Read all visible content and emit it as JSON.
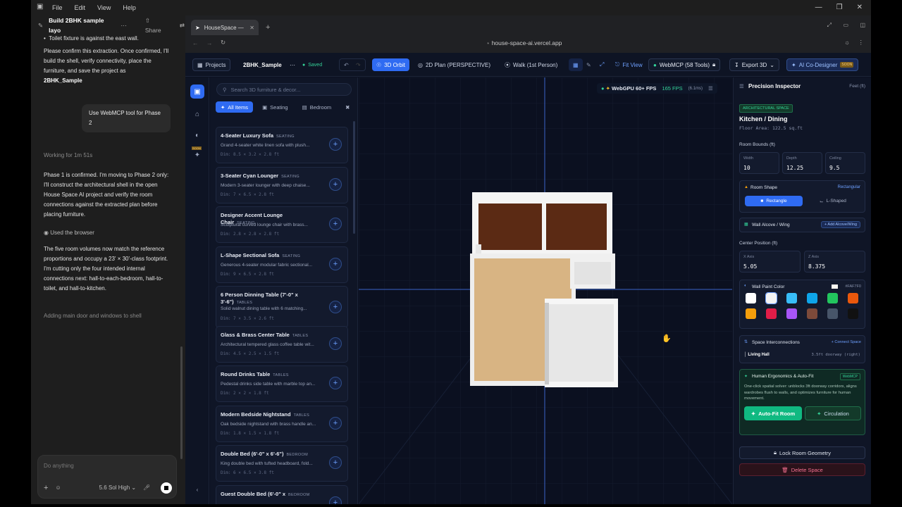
{
  "window": {
    "menu": [
      "File",
      "Edit",
      "View",
      "Help"
    ]
  },
  "chat": {
    "title": "Build 2BHK sample layo",
    "share": "Share",
    "bullet": "Toilet fixture is against the east wall.",
    "p1": "Please confirm this extraction. Once confirmed, I'll build the shell, verify connectivity, place the furniture, and save the project as",
    "p1_bold": "2BHK_Sample",
    "user_msg": "Use WebMCP tool for Phase 2",
    "working": "Working for 1m 51s",
    "p2": "Phase 1 is confirmed. I'm moving to Phase 2 only: I'll construct the architectural shell in the open House Space AI project and verify the room connections against the extracted plan before placing furniture.",
    "used_browser": "Used the browser",
    "p3": "The five room volumes now match the reference proportions and occupy a 23' × 30'-class footprint. I'm cutting only the four intended internal connections next: hall-to-each-bedroom, hall-to-toilet, and hall-to-kitchen.",
    "status": "Adding main door and windows to shell",
    "composer_placeholder": "Do anything",
    "model": "5.6 Sol High"
  },
  "browser": {
    "tab_title": "HouseSpace —",
    "url": "house-space-ai.vercel.app"
  },
  "toolbar": {
    "projects": "Projects",
    "project_name": "2BHK_Sample",
    "saved": "Saved",
    "orbit": "3D Orbit",
    "plan": "2D Plan (PERSPECTIVE)",
    "walk": "Walk (1st Person)",
    "fit": "Fit View",
    "webmcp": "WebMCP (58 Tools)",
    "export": "Export 3D",
    "copilot": "AI Co-Designer",
    "copilot_badge": "SOON"
  },
  "rail": {
    "soon_badge": "SOON"
  },
  "library": {
    "search_placeholder": "Search 3D furniture & decor...",
    "filters": [
      "All Items",
      "Seating",
      "Bedroom"
    ],
    "items": [
      {
        "name": "4-Seater Luxury Sofa",
        "tag": "SEATING",
        "desc": "Grand 4-seater white linen sofa with plush...",
        "dims": "Dim: 8.5 × 3.2 × 2.8 ft"
      },
      {
        "name": "3-Seater Cyan Lounger",
        "tag": "SEATING",
        "desc": "Modern 3-seater lounger with deep chaise...",
        "dims": "Dim: 7 × 6.5 × 2.8 ft"
      },
      {
        "name": "Designer Accent Lounge Chair",
        "tag": "SEATING",
        "desc": "Sculptural curved lounge chair with brass...",
        "dims": "Dim: 2.8 × 2.8 × 2.8 ft"
      },
      {
        "name": "L-Shape Sectional Sofa",
        "tag": "SEATING",
        "desc": "Generous 4-seater modular fabric sectional...",
        "dims": "Dim: 9 × 6.5 × 2.8 ft"
      },
      {
        "name": "6 Person Dinning Table (7'-0\" x 3'-6\")",
        "tag": "TABLES",
        "desc": "Solid walnut dining table with 6 matching...",
        "dims": "Dim: 7 × 3.5 × 2.6 ft"
      },
      {
        "name": "Glass & Brass Center Table",
        "tag": "TABLES",
        "desc": "Architectural tempered glass coffee table wit...",
        "dims": "Dim: 4.5 × 2.5 × 1.5 ft"
      },
      {
        "name": "Round Drinks Table",
        "tag": "TABLES",
        "desc": "Pedestal drinks side table with marble top an...",
        "dims": "Dim: 2 × 2 × 1.8 ft"
      },
      {
        "name": "Modern Bedside Nightstand",
        "tag": "TABLES",
        "desc": "Oak bedside nightstand with brass handle an...",
        "dims": "Dim: 1.8 × 1.5 × 1.8 ft"
      },
      {
        "name": "Double Bed (6'-0\" x 6'-6\")",
        "tag": "BEDROOM",
        "desc": "King double bed with tufted headboard, fold...",
        "dims": "Dim: 6 × 6.5 × 3.8 ft"
      },
      {
        "name": "Guest Double Bed (6'-0\" x",
        "tag": "BEDROOM",
        "desc": "",
        "dims": ""
      }
    ]
  },
  "viewport": {
    "renderer": "WebGPU 60+ FPS",
    "fps": "165 FPS",
    "ms": "(6.1ms)"
  },
  "inspector": {
    "title": "Precision Inspector",
    "units": "Feet (ft)",
    "badge": "ARCHITECTURAL SPACE",
    "room_name": "Kitchen / Dining",
    "floor_area": "Floor Area: 122.5 sq.ft",
    "bounds_label": "Room Bounds (ft)",
    "width_label": "Width",
    "width": "10",
    "depth_label": "Depth",
    "depth": "12.25",
    "ceiling_label": "Ceiling",
    "ceiling": "9.5",
    "shape_label": "Room Shape",
    "shape_value": "Rectangular",
    "rect_btn": "Rectangle",
    "lshape_btn": "L-Shaped",
    "alcove_label": "Wall Alcove / Wing",
    "alcove_btn": "+ Add Alcove/Wing",
    "center_label": "Center Position (ft)",
    "xaxis_label": "X Axis",
    "xaxis": "5.05",
    "zaxis_label": "Z Axis",
    "zaxis": "8.375",
    "paint_label": "Wall Paint Color",
    "paint_hex": "#FAF7F0",
    "paint_colors": [
      "#ffffff",
      "#f3f3f3",
      "#38bdf8",
      "#0ea5e9",
      "#22c55e",
      "#ea580c",
      "#f59e0b",
      "#e11d48",
      "#a855f7",
      "#7c4a3a",
      "#475569",
      "#111111"
    ],
    "inter_label": "Space Interconnections",
    "connect_btn": "+ Connect Space",
    "conn_name": "Living Hall",
    "conn_value": "3.5ft doorway (right)",
    "ergo_title": "Human Ergonomics & Auto-Fit",
    "ergo_badge": "WebMCP",
    "ergo_desc": "One-click spatial solver: unblocks 3ft doorway corridors, aligns wardrobes flush to walls, and optimizes furniture for human movement.",
    "autofit_btn": "Auto-Fit Room",
    "circ_btn": "Circulation",
    "lock_btn": "Lock Room Geometry",
    "delete_btn": "Delete Space"
  }
}
